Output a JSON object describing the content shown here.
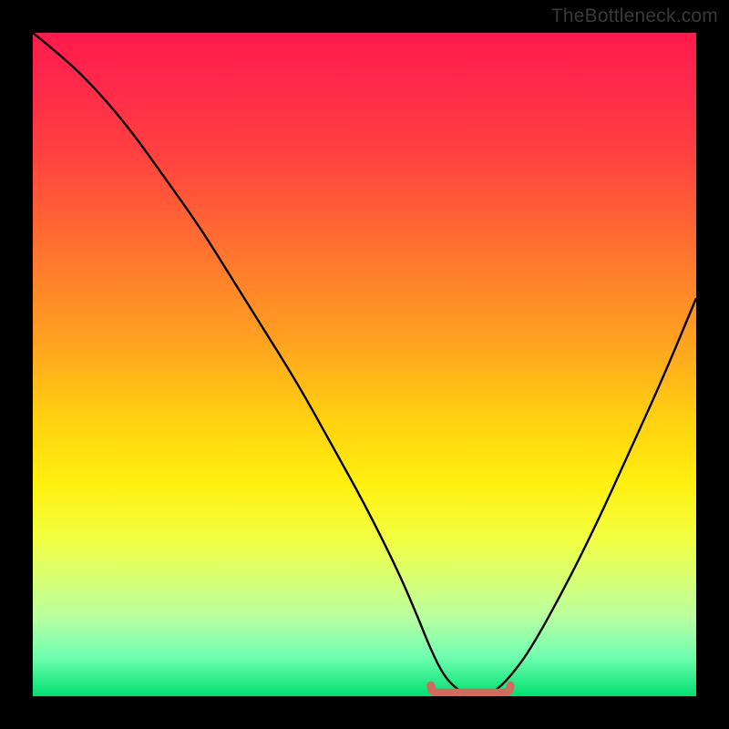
{
  "credit": "TheBottleneck.com",
  "chart_data": {
    "type": "line",
    "title": "",
    "xlabel": "",
    "ylabel": "",
    "xlim": [
      0,
      100
    ],
    "ylim": [
      0,
      100
    ],
    "grid": false,
    "series": [
      {
        "name": "curve",
        "x": [
          0,
          5,
          10,
          15,
          20,
          25,
          30,
          35,
          40,
          45,
          50,
          55,
          58,
          60,
          62,
          64,
          66,
          68,
          70,
          72,
          75,
          80,
          85,
          90,
          95,
          100
        ],
        "values": [
          100,
          96,
          91,
          85,
          78,
          71,
          63,
          55,
          47,
          38,
          29,
          19,
          12,
          7,
          3,
          1,
          0,
          0,
          1,
          3,
          7,
          16,
          26,
          37,
          48,
          60
        ]
      }
    ],
    "plateau": {
      "start_x": 60,
      "end_x": 72,
      "y": 0.8
    },
    "colors": {
      "curve_stroke": "#000000",
      "plateau_stroke": "#d46a5e",
      "gradient_top": "#ff1a4d",
      "gradient_bottom": "#00e070"
    }
  }
}
